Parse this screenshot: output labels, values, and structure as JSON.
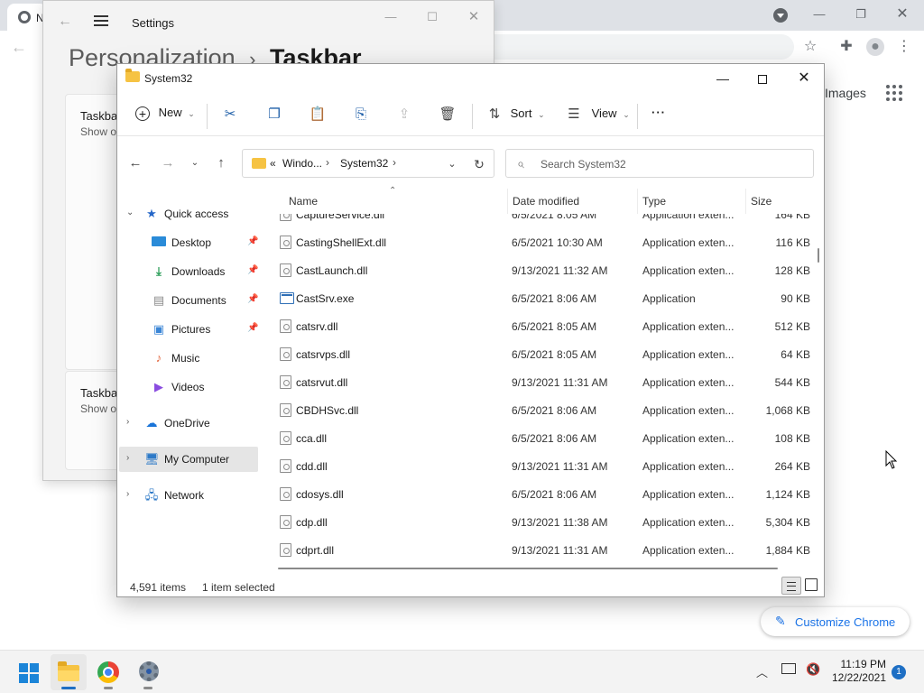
{
  "chrome": {
    "tab_title": "N"
  },
  "settings": {
    "title": "Settings",
    "breadcrumb_parent": "Personalization",
    "breadcrumb_sep": "›",
    "breadcrumb_current": "Taskbar",
    "cards": [
      {
        "title": "Taskba",
        "desc": "Show o"
      },
      {
        "title": "Taskba",
        "desc": "Show o"
      }
    ]
  },
  "chrome_page": {
    "images_link": "Images",
    "customize_label": "Customize Chrome"
  },
  "explorer": {
    "title": "System32",
    "toolbar": {
      "new_label": "New",
      "sort_label": "Sort",
      "view_label": "View",
      "more_label": "···"
    },
    "address": {
      "prefix": "«",
      "segments": [
        "Windo...",
        "System32"
      ]
    },
    "search": {
      "placeholder": "Search System32"
    },
    "nav": {
      "quick_access": "Quick access",
      "items": [
        {
          "label": "Desktop",
          "icon": "desktop-icon"
        },
        {
          "label": "Downloads",
          "icon": "downloads-icon"
        },
        {
          "label": "Documents",
          "icon": "documents-icon"
        },
        {
          "label": "Pictures",
          "icon": "pictures-icon"
        },
        {
          "label": "Music",
          "icon": "music-icon"
        },
        {
          "label": "Videos",
          "icon": "videos-icon"
        }
      ],
      "onedrive": "OneDrive",
      "my_computer": "My Computer",
      "network": "Network"
    },
    "columns": {
      "name": "Name",
      "date": "Date modified",
      "type": "Type",
      "size": "Size"
    },
    "files": [
      {
        "name": "CaptureService.dll",
        "date": "6/5/2021 8:05 AM",
        "type": "Application exten...",
        "size": "164 KB"
      },
      {
        "name": "CastingShellExt.dll",
        "date": "6/5/2021 10:30 AM",
        "type": "Application exten...",
        "size": "116 KB"
      },
      {
        "name": "CastLaunch.dll",
        "date": "9/13/2021 11:32 AM",
        "type": "Application exten...",
        "size": "128 KB"
      },
      {
        "name": "CastSrv.exe",
        "date": "6/5/2021 8:06 AM",
        "type": "Application",
        "size": "90 KB",
        "kind": "exe"
      },
      {
        "name": "catsrv.dll",
        "date": "6/5/2021 8:05 AM",
        "type": "Application exten...",
        "size": "512 KB"
      },
      {
        "name": "catsrvps.dll",
        "date": "6/5/2021 8:05 AM",
        "type": "Application exten...",
        "size": "64 KB"
      },
      {
        "name": "catsrvut.dll",
        "date": "9/13/2021 11:31 AM",
        "type": "Application exten...",
        "size": "544 KB"
      },
      {
        "name": "CBDHSvc.dll",
        "date": "6/5/2021 8:06 AM",
        "type": "Application exten...",
        "size": "1,068 KB"
      },
      {
        "name": "cca.dll",
        "date": "6/5/2021 8:06 AM",
        "type": "Application exten...",
        "size": "108 KB"
      },
      {
        "name": "cdd.dll",
        "date": "9/13/2021 11:31 AM",
        "type": "Application exten...",
        "size": "264 KB"
      },
      {
        "name": "cdosys.dll",
        "date": "6/5/2021 8:06 AM",
        "type": "Application exten...",
        "size": "1,124 KB"
      },
      {
        "name": "cdp.dll",
        "date": "9/13/2021 11:38 AM",
        "type": "Application exten...",
        "size": "5,304 KB"
      },
      {
        "name": "cdprt.dll",
        "date": "9/13/2021 11:31 AM",
        "type": "Application exten...",
        "size": "1,884 KB"
      }
    ],
    "status": {
      "item_count": "4,591 items",
      "selection": "1 item selected"
    }
  },
  "taskbar": {
    "time": "11:19 PM",
    "date": "12/22/2021",
    "notification_count": "1"
  }
}
